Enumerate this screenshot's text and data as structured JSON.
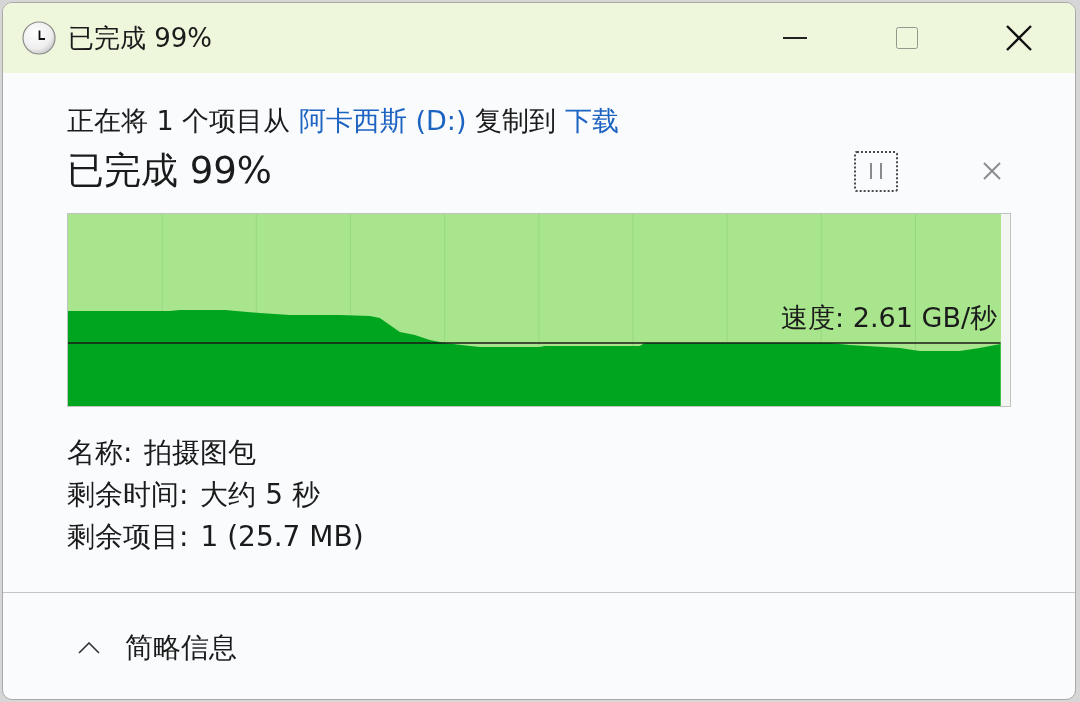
{
  "window": {
    "title": "已完成 99%"
  },
  "description": [
    {
      "kind": "text",
      "text": "正在将 1 个项目从"
    },
    {
      "kind": "link",
      "text": "阿卡西斯 (D:)"
    },
    {
      "kind": "text",
      "text": "复制到"
    },
    {
      "kind": "link",
      "text": "下载"
    }
  ],
  "progress": {
    "heading": "已完成 99%",
    "level": 0.99,
    "speed": "速度: 2.61 GB/秒"
  },
  "details": [
    {
      "label": "名称:",
      "value": "拍摄图包"
    },
    {
      "label": "剩余时间:",
      "value": "大约 5 秒"
    },
    {
      "label": "剩余项目:",
      "value": "1 (25.7 MB)"
    }
  ],
  "details_toggle": {
    "label": "简略信息",
    "expanded": true
  }
}
